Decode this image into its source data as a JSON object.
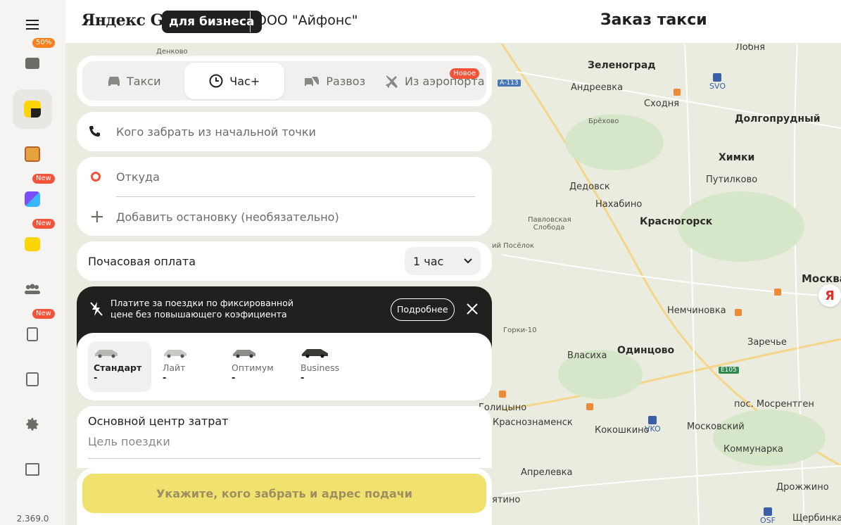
{
  "sidebar": {
    "menu_icon": "hamburger-icon",
    "items": [
      {
        "name": "briefcase",
        "icon": "briefcase-icon",
        "badge": "50%"
      },
      {
        "name": "taxi",
        "icon": "taxi-icon",
        "badge": ""
      },
      {
        "name": "delivery",
        "icon": "box-icon",
        "badge": ""
      },
      {
        "name": "apps",
        "icon": "apps-icon",
        "badge": "New"
      },
      {
        "name": "eats",
        "icon": "eats-icon",
        "badge": "New"
      },
      {
        "name": "users",
        "icon": "users-icon",
        "badge": ""
      },
      {
        "name": "reports",
        "icon": "report-icon",
        "badge": "New"
      },
      {
        "name": "documents",
        "icon": "document-icon",
        "badge": ""
      },
      {
        "name": "settings",
        "icon": "gear-icon",
        "badge": ""
      },
      {
        "name": "gifts",
        "icon": "gift-icon",
        "badge": ""
      }
    ],
    "version": "2.369.0"
  },
  "header": {
    "logo_text": "Яндекс Go",
    "logo_badge": "для бизнеса",
    "company": "ООО \"Айфонс\"",
    "title": "Заказ такси"
  },
  "tabs": [
    {
      "label": "Такси",
      "icon": "car-icon"
    },
    {
      "label": "Час+",
      "icon": "clock-ruble-icon",
      "active": true
    },
    {
      "label": "Развоз",
      "icon": "cars-icon"
    },
    {
      "label": "Из аэропорта",
      "icon": "plane-icon",
      "badge": "Новое"
    }
  ],
  "form": {
    "pickup_contact_placeholder": "Кого забрать из начальной точки",
    "from_placeholder": "Откуда",
    "add_stop_placeholder": "Добавить остановку (необязательно)",
    "hourly_label": "Почасовая оплата",
    "hourly_value": "1 час"
  },
  "promo": {
    "text": "Платите за поездки по фиксированной цене без повышающего коэфициента",
    "button": "Подробнее"
  },
  "tariffs": [
    {
      "name": "Стандарт",
      "price": "-",
      "active": true
    },
    {
      "name": "Лайт",
      "price": "-"
    },
    {
      "name": "Оптимум",
      "price": "-"
    },
    {
      "name": "Business",
      "price": "-"
    }
  ],
  "cost_center": {
    "title": "Основной центр затрат",
    "purpose_placeholder": "Цель поездки"
  },
  "submit_label": "Укажите, кого забрать и адрес подачи",
  "map": {
    "labels": {
      "zelenograd": "Зеленоград",
      "andreevka": "Андреевка",
      "skhodnya": "Сходня",
      "dolgoprudny": "Долгопрудный",
      "khimki": "Химки",
      "putilkovo": "Путилково",
      "dedovsk": "Дедовск",
      "nakhabino": "Нахабино",
      "krasnogorsk": "Красногорск",
      "pavlovskaya": "Павловская Слобода",
      "moskva": "Москва",
      "nemchinovka": "Немчиновка",
      "zarechye": "Заречье",
      "odintsovo": "Одинцово",
      "vlasikha": "Власиха",
      "gorki": "Горки-10",
      "golitsyno": "Голицыно",
      "krasnoznamensk": "Краснознаменск",
      "kokoshkino": "Кокошкино",
      "moskovsky": "Московский",
      "mosrentgen": "пос. Мосрентген",
      "kommunarka": "Коммунарка",
      "aprelevka": "Апрелевка",
      "drozhzhino": "Дрожжино",
      "shcherbinka": "Щербинка",
      "lobnya": "Лобня",
      "denkovo": "Денково",
      "brekhovo": "Брёхово",
      "rechnoy": "ий Посёлок",
      "yatino": "ятино"
    },
    "airports": {
      "svo": "SVO",
      "vko": "VKO",
      "osf": "OSF"
    },
    "shields": {
      "a113": "А-113",
      "e105": "E105"
    },
    "yandex_marker": "Я"
  }
}
